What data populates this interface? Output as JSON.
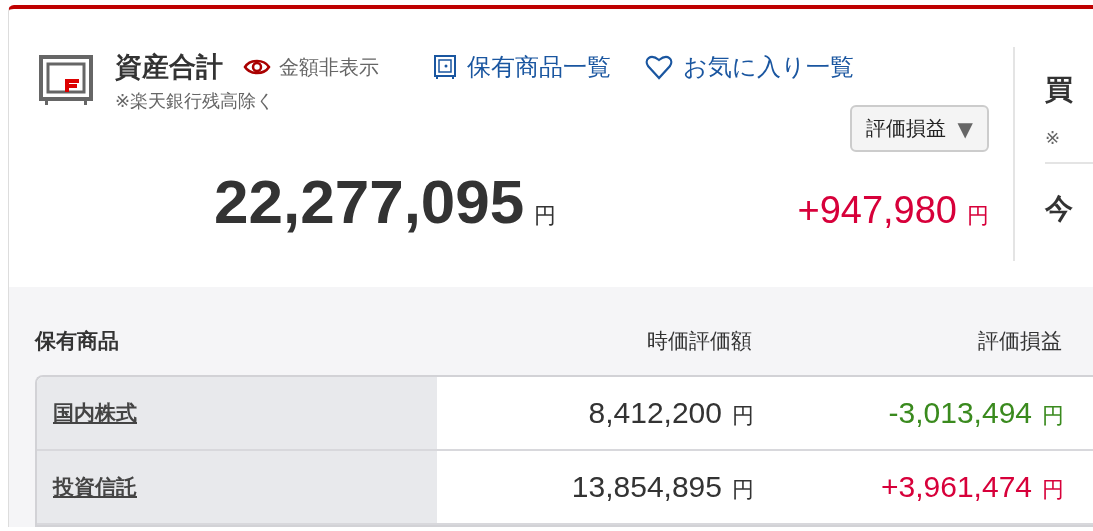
{
  "summary": {
    "title": "資産合計",
    "hide_amounts": "金額非表示",
    "note": "※楽天銀行残高除く",
    "links": [
      {
        "label": "保有商品一覧",
        "kind": "holdings"
      },
      {
        "label": "お気に入り一覧",
        "kind": "favorites"
      }
    ],
    "dropdown": "評価損益",
    "dropdown_caret": "▼",
    "total": "22,277,095",
    "total_unit": "円",
    "profit": {
      "value": "+947,980",
      "color": "#d7003a",
      "unit": "円"
    }
  },
  "side_panel": {
    "heading": "買",
    "note": "※",
    "heading_2": "今"
  },
  "holdings": {
    "title": "保有商品",
    "columns": [
      "時価評価額",
      "評価損益"
    ],
    "rows": [
      {
        "name": "国内株式",
        "value": "8,412,200",
        "value_unit": "円",
        "profit": "-3,013,494",
        "color": "#3a8a1e",
        "profit_unit": "円"
      },
      {
        "name": "投資信託",
        "value": "13,854,895",
        "value_unit": "円",
        "profit": "+3,961,474",
        "color": "#d7003a",
        "profit_unit": "円"
      }
    ]
  }
}
